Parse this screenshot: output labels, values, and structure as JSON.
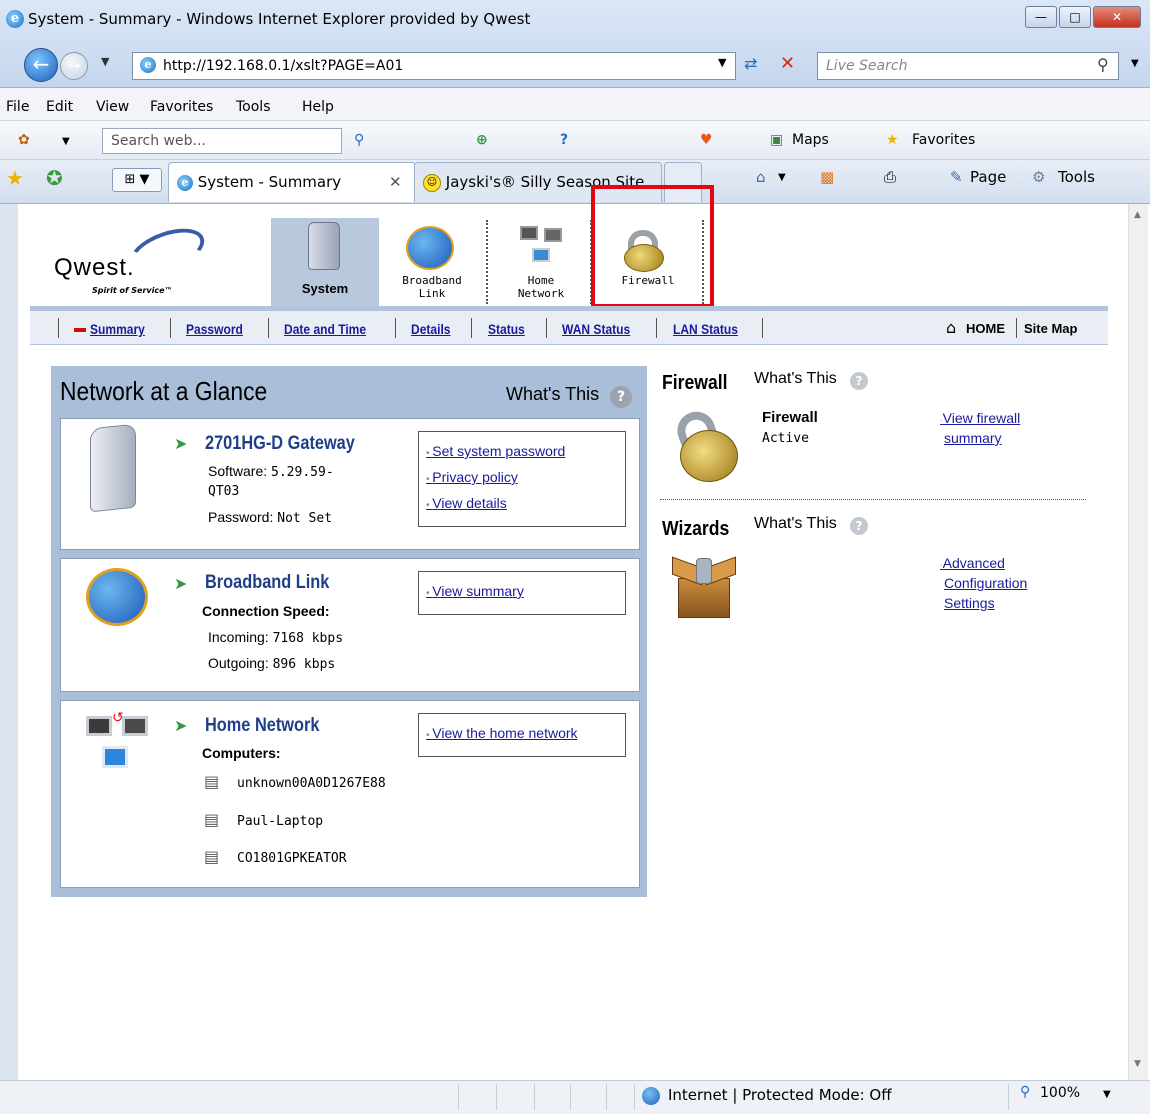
{
  "window": {
    "title": "System - Summary - Windows Internet Explorer provided by Qwest",
    "buttons": {
      "minimize": "—",
      "maximize": "□",
      "close": "✕"
    }
  },
  "address_bar": {
    "url": "http://192.168.0.1/xslt?PAGE=A01"
  },
  "live_search": {
    "placeholder": "Live Search"
  },
  "menu": [
    "File",
    "Edit",
    "View",
    "Favorites",
    "Tools",
    "Help"
  ],
  "toolbar": {
    "search_placeholder": "Search web...",
    "maps": "Maps",
    "favorites": "Favorites"
  },
  "tabs": [
    {
      "label": "System - Summary",
      "close": "✕"
    },
    {
      "label": "Jayski's® Silly Season Site"
    }
  ],
  "command_bar": {
    "page": "Page",
    "tools": "Tools"
  },
  "router": {
    "logo": {
      "name": "Qwest.",
      "tagline": "Spirit of Service™"
    },
    "nav": [
      {
        "label": "System"
      },
      {
        "label": "Broadband\nLink"
      },
      {
        "label": "Home\nNetwork"
      },
      {
        "label": "Firewall"
      }
    ],
    "subnav": [
      "Summary",
      "Password",
      "Date and Time",
      "Details",
      "Status",
      "WAN Status",
      "LAN Status"
    ],
    "home": "HOME",
    "sitemap": "Site Map"
  },
  "glance": {
    "title": "Network at a Glance",
    "whats_this": "What's This",
    "gateway": {
      "title": "2701HG-D Gateway",
      "software_label": "Software:",
      "software_value": "5.29.59-",
      "software_value2": "QT03",
      "password_label": "Password:",
      "password_value": "Not Set",
      "links": [
        "Set system password",
        "Privacy policy",
        "View details"
      ]
    },
    "broadband": {
      "title": "Broadband Link",
      "speed_label": "Connection Speed:",
      "incoming_label": "Incoming:",
      "incoming_value": "7168 kbps",
      "outgoing_label": "Outgoing:",
      "outgoing_value": "896 kbps",
      "links": [
        "View summary"
      ]
    },
    "home_network": {
      "title": "Home Network",
      "computers_label": "Computers:",
      "computers": [
        "unknown00A0D1267E88",
        "Paul-Laptop",
        "CO1801GPKEATOR"
      ],
      "links": [
        "View the home network"
      ]
    }
  },
  "firewall": {
    "heading": "Firewall",
    "whats_this": "What's This",
    "label": "Firewall",
    "status": "Active",
    "link1": "View firewall",
    "link2": "summary"
  },
  "wizards": {
    "heading": "Wizards",
    "whats_this": "What's This",
    "link1": "Advanced",
    "link2": "Configuration",
    "link3": "Settings"
  },
  "status_bar": {
    "zone": "Internet | Protected Mode: Off",
    "zoom": "100%"
  },
  "colors": {
    "accent": "#1f3f8a",
    "highlight_box": "#e30613",
    "panel": "#a9bed8"
  }
}
